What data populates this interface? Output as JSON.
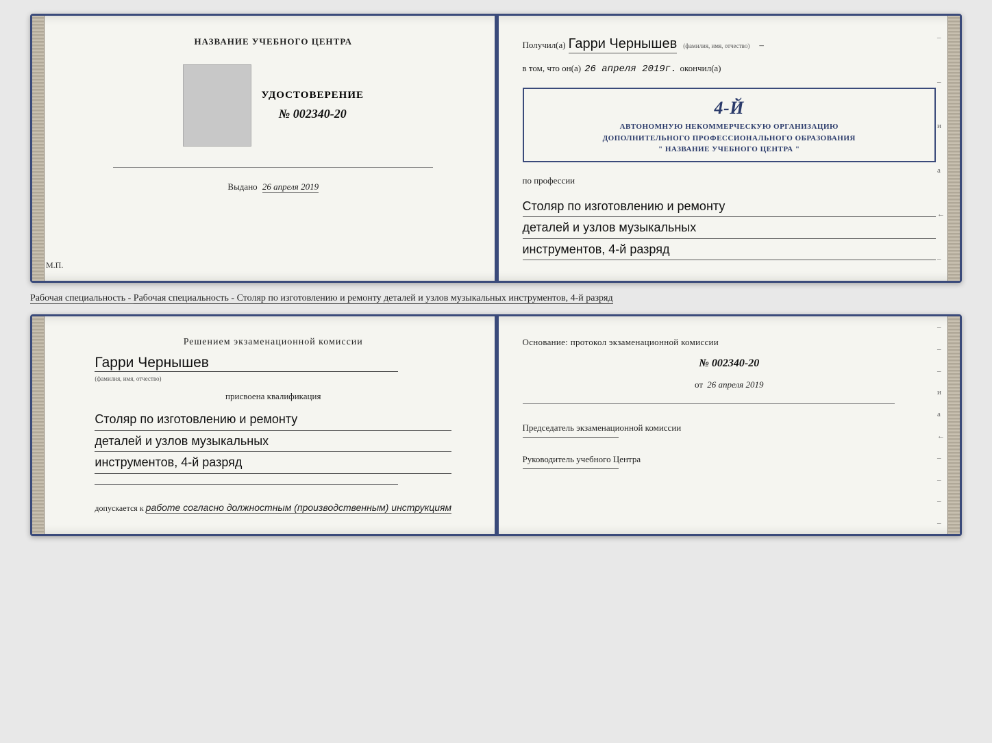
{
  "top_doc": {
    "left": {
      "title": "НАЗВАНИЕ УЧЕБНОГО ЦЕНТРА",
      "udost_label": "УДОСТОВЕРЕНИЕ",
      "udost_number": "№ 002340-20",
      "vydano_label": "Выдано",
      "vydano_date": "26 апреля 2019",
      "mp": "М.П."
    },
    "right": {
      "poluchil_prefix": "Получил(а)",
      "fio": "Гарри Чернышев",
      "fio_sub": "(фамилия, имя, отчество)",
      "vtom_prefix": "в том, что он(а)",
      "vtom_date": "26 апреля 2019г.",
      "okoncil": "окончил(а)",
      "stamp_line1": "АВТОНОМНУЮ НЕКОММЕРЧЕСКУЮ ОРГАНИЗАЦИЮ",
      "stamp_line2": "ДОПОЛНИТЕЛЬНОГО ПРОФЕССИОНАЛЬНОГО ОБРАЗОВАНИЯ",
      "stamp_line3": "\" НАЗВАНИЕ УЧЕБНОГО ЦЕНТРА \"",
      "stamp_big": "4-й",
      "po_professii": "по профессии",
      "profession_line1": "Столяр по изготовлению и ремонту",
      "profession_line2": "деталей и узлов музыкальных",
      "profession_line3": "инструментов, 4-й разряд"
    }
  },
  "between": {
    "text": "Рабочая специальность - Столяр по изготовлению и ремонту деталей и узлов музыкальных инструментов, 4-й разряд"
  },
  "bottom_doc": {
    "left": {
      "resheniem": "Решением экзаменационной комиссии",
      "fio": "Гарри Чернышев",
      "fio_sub": "(фамилия, имя, отчество)",
      "prisvoyena": "присвоена квалификация",
      "profession_line1": "Столяр по изготовлению и ремонту",
      "profession_line2": "деталей и узлов музыкальных",
      "profession_line3": "инструментов, 4-й разряд",
      "dopusk_prefix": "допускается к",
      "dopusk_text": "работе согласно должностным (производственным) инструкциям"
    },
    "right": {
      "osnovaniye": "Основание: протокол экзаменационной комиссии",
      "number": "№ 002340-20",
      "ot_prefix": "от",
      "ot_date": "26 апреля 2019",
      "chairman_title": "Председатель экзаменационной комиссии",
      "rukevod_title": "Руководитель учебного Центра"
    }
  },
  "right_edge": {
    "marks": [
      "и",
      "а",
      "←",
      "–",
      "–",
      "–",
      "–"
    ]
  }
}
